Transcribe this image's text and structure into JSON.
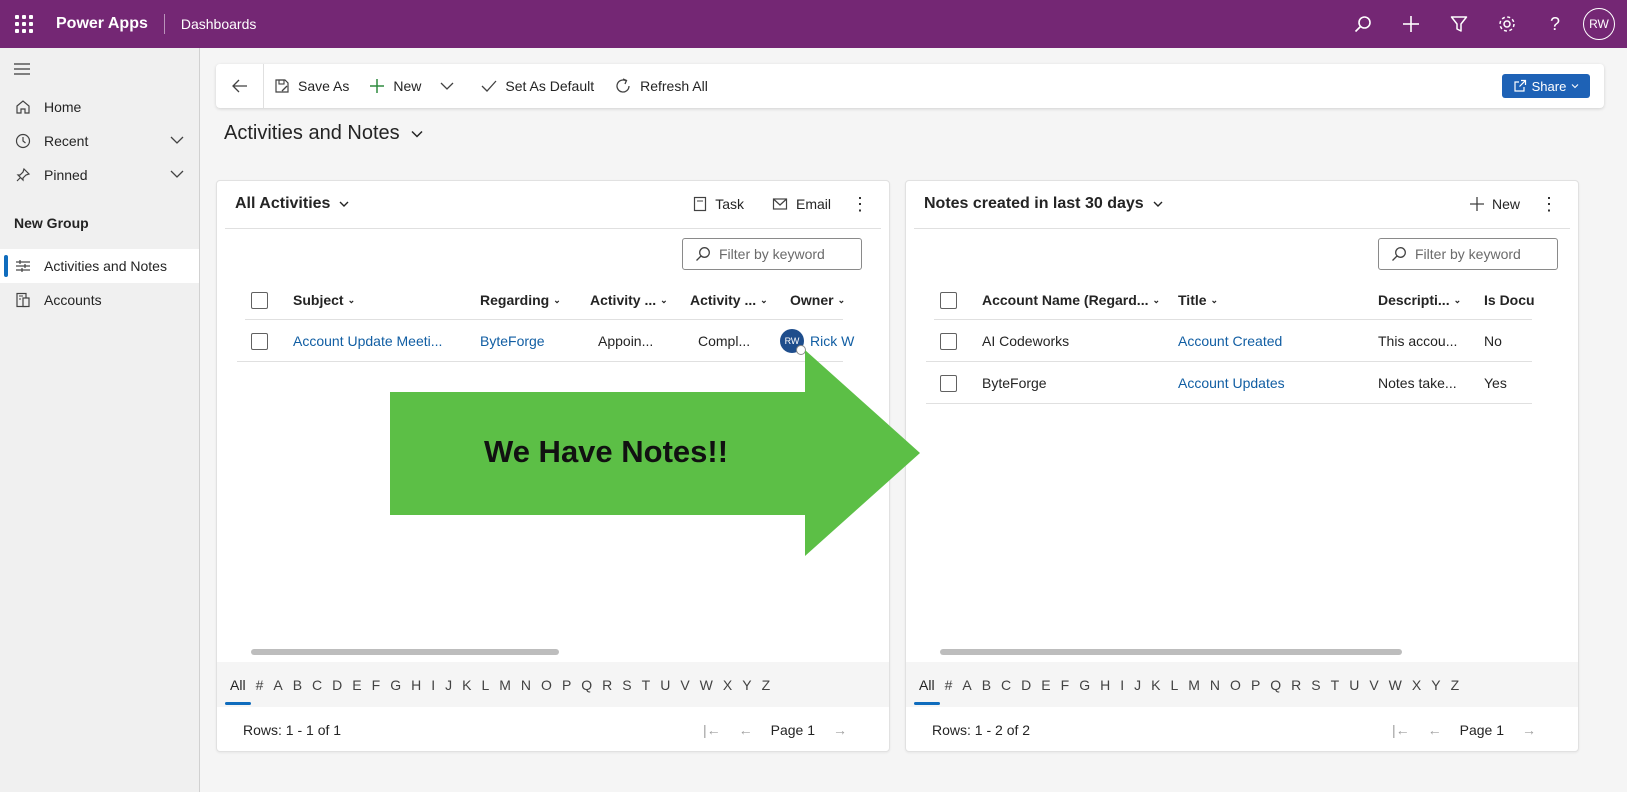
{
  "topbar": {
    "app_name": "Power Apps",
    "area_name": "Dashboards",
    "user_initials": "RW",
    "icons": [
      "search-icon",
      "add-icon",
      "filter-icon",
      "settings-icon",
      "help-icon"
    ]
  },
  "sidebar": {
    "items": [
      {
        "label": "Home",
        "icon": "home-icon"
      },
      {
        "label": "Recent",
        "icon": "clock-icon"
      },
      {
        "label": "Pinned",
        "icon": "pin-icon"
      }
    ],
    "group_label": "New Group",
    "group_items": [
      {
        "label": "Activities and Notes",
        "icon": "dashboard-icon",
        "active": true
      },
      {
        "label": "Accounts",
        "icon": "accounts-icon",
        "active": false
      }
    ]
  },
  "commandbar": {
    "save_as": "Save As",
    "new": "New",
    "set_default": "Set As Default",
    "refresh": "Refresh All",
    "share": "Share"
  },
  "dashboard": {
    "title": "Activities and Notes"
  },
  "activities": {
    "title": "All Activities",
    "task": "Task",
    "email": "Email",
    "filter_placeholder": "Filter by keyword",
    "columns": [
      "Subject",
      "Regarding",
      "Activity ...",
      "Activity ...",
      "Owner"
    ],
    "rows": [
      {
        "subject": "Account Update Meeti...",
        "regarding": "ByteForge",
        "type": "Appoin...",
        "status": "Compl...",
        "owner_initials": "RW",
        "owner": "Rick W"
      }
    ],
    "alphabet": [
      "All",
      "#",
      "A",
      "B",
      "C",
      "D",
      "E",
      "F",
      "G",
      "H",
      "I",
      "J",
      "K",
      "L",
      "M",
      "N",
      "O",
      "P",
      "Q",
      "R",
      "S",
      "T",
      "U",
      "V",
      "W",
      "X",
      "Y",
      "Z"
    ],
    "rows_count": "Rows: 1 - 1 of 1",
    "page": "Page 1"
  },
  "notes": {
    "title": "Notes created in last 30 days",
    "new": "New",
    "filter_placeholder": "Filter by keyword",
    "columns": [
      "Account Name (Regard...",
      "Title",
      "Descripti...",
      "Is Docu"
    ],
    "rows": [
      {
        "account": "AI Codeworks",
        "title": "Account Created",
        "description": "This accou...",
        "is_doc": "No"
      },
      {
        "account": "ByteForge",
        "title": "Account Updates",
        "description": "Notes take...",
        "is_doc": "Yes"
      }
    ],
    "alphabet": [
      "All",
      "#",
      "A",
      "B",
      "C",
      "D",
      "E",
      "F",
      "G",
      "H",
      "I",
      "J",
      "K",
      "L",
      "M",
      "N",
      "O",
      "P",
      "Q",
      "R",
      "S",
      "T",
      "U",
      "V",
      "W",
      "X",
      "Y",
      "Z"
    ],
    "rows_count": "Rows: 1 - 2 of 2",
    "page": "Page 1"
  },
  "callout": {
    "text": "We Have Notes!!",
    "color": "#5cbf46"
  },
  "colors": {
    "brand": "#742774",
    "link": "#115ea3",
    "accent": "#0f6cbd"
  }
}
